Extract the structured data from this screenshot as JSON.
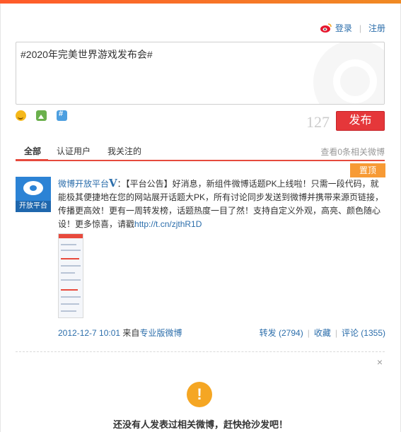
{
  "header": {
    "login_label": "登录",
    "register_label": "注册"
  },
  "composer": {
    "text": "#2020年完美世界游戏发布会#",
    "remaining_count": "127",
    "publish_label": "发布",
    "tools": [
      "emoji-icon",
      "image-icon",
      "topic-icon"
    ]
  },
  "tabs": {
    "items": [
      {
        "label": "全部"
      },
      {
        "label": "认证用户"
      },
      {
        "label": "我关注的"
      }
    ],
    "related_link": "查看0条相关微博",
    "pinned_label": "置顶"
  },
  "post": {
    "avatar_caption": "开放平台",
    "author": "微博开放平台",
    "verified_badge": "V",
    "content": "：【平台公告】好消息，新组件微博话题PK上线啦！只需一段代码，就能极其便捷地在您的网站展开话题大PK，所有讨论同步发送到微博并携带来源页链接，传播更高效！更有一周转发榜，话题热度一目了然！支持自定义外观，高亮、颜色随心设！更多惊喜，请戳",
    "link": "http://t.cn/zjthR1D",
    "timestamp": "2012-12-7 10:01",
    "source_prefix": "来自",
    "source": "专业版微博",
    "repost": "转发 (2794)",
    "favorite": "收藏",
    "comment": "评论 (1355)"
  },
  "empty_state": {
    "message": "还没有人发表过相关微博，赶快抢沙发吧！"
  },
  "colors": {
    "accent": "#e64a3d",
    "publish_button": "#e5373a",
    "link": "#2c6eab",
    "pin_badge": "#f79a35",
    "warning_icon": "#f5a623"
  }
}
